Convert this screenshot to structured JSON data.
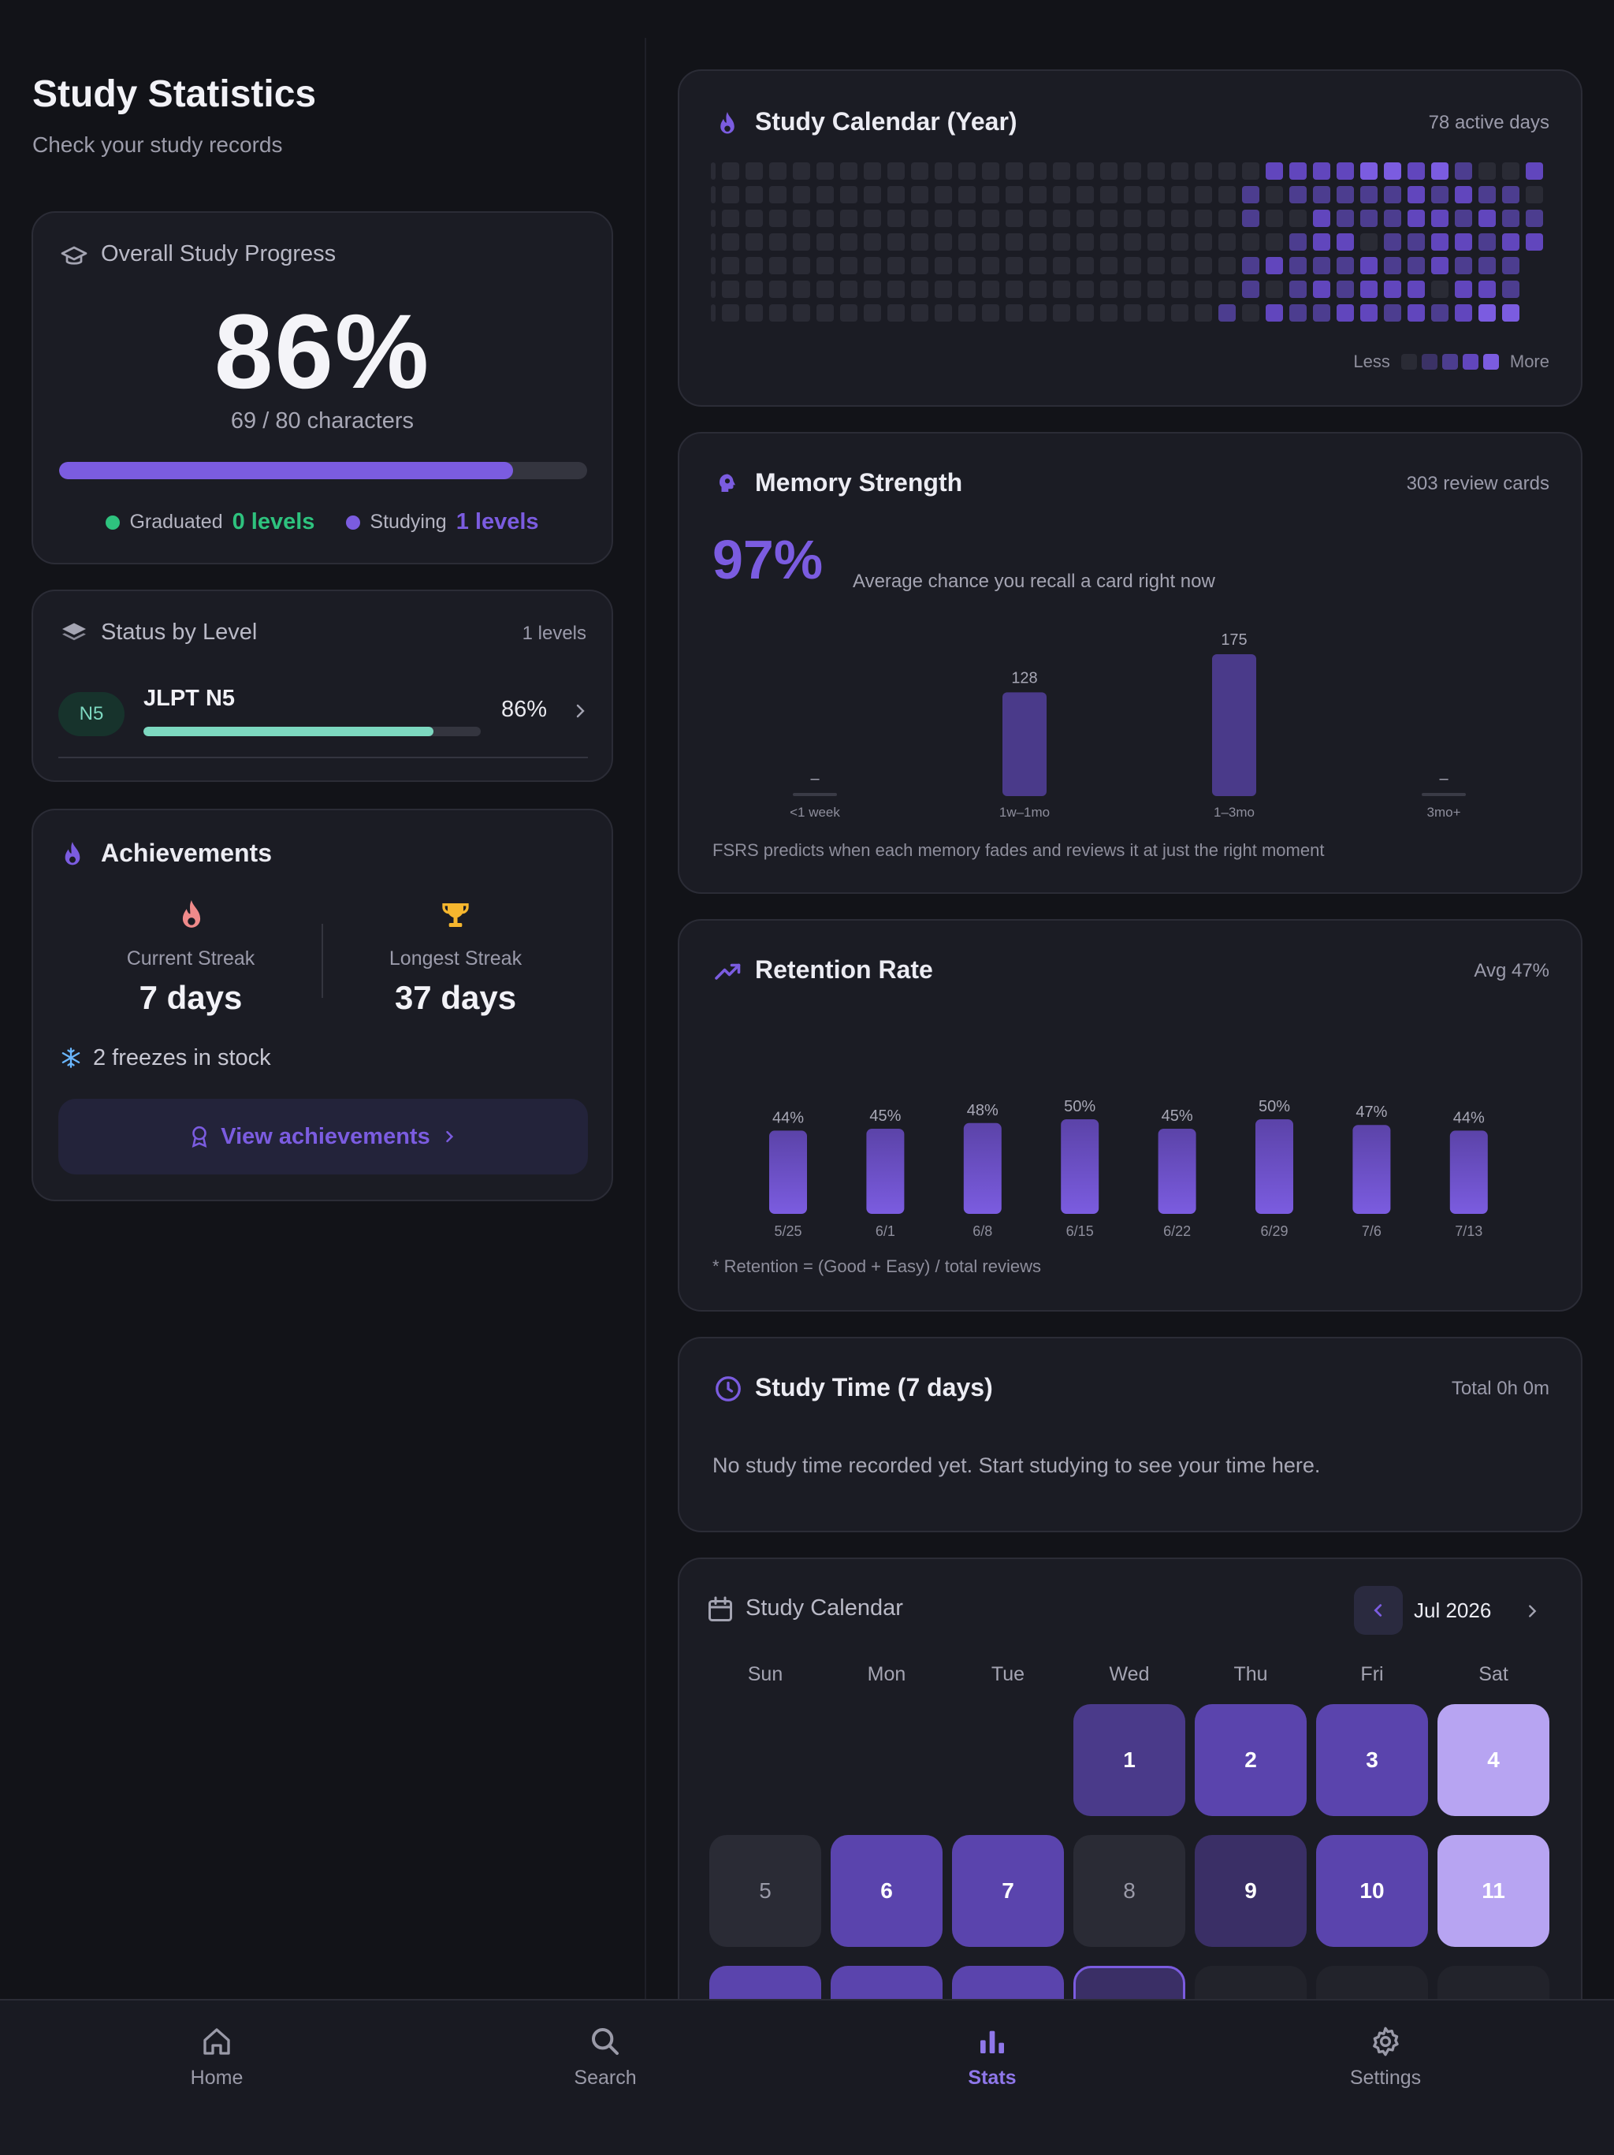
{
  "page": {
    "title": "Study Statistics",
    "subtitle": "Check your study records"
  },
  "overall": {
    "title": "Overall Study Progress",
    "percent": "86%",
    "count": "69 / 80 characters",
    "progress": 0.86,
    "graduated_label": "Graduated",
    "graduated_value": "0 levels",
    "studying_label": "Studying",
    "studying_value": "1 levels"
  },
  "levels": {
    "title": "Status by Level",
    "count": "1 levels",
    "items": [
      {
        "badge": "N5",
        "name": "JLPT N5",
        "percent": "86%",
        "progress": 0.86
      }
    ]
  },
  "achievements": {
    "title": "Achievements",
    "current_label": "Current Streak",
    "current_value": "7 days",
    "longest_label": "Longest Streak",
    "longest_value": "37 days",
    "freezes": "2 freezes in stock",
    "button": "View achievements"
  },
  "year_calendar": {
    "title": "Study Calendar (Year)",
    "active": "78 active days",
    "legend_less": "Less",
    "legend_more": "More"
  },
  "memory": {
    "title": "Memory Strength",
    "cards": "303 review cards",
    "percent": "97%",
    "caption": "Average chance you recall a card right now",
    "footnote": "FSRS predicts when each memory fades and reviews it at just the right moment",
    "chart_data": {
      "type": "bar",
      "categories": [
        "<1 week",
        "1w–1mo",
        "1–3mo",
        "3mo+"
      ],
      "values": [
        0,
        128,
        175,
        0
      ],
      "labels": [
        "–",
        "128",
        "175",
        "–"
      ],
      "ylim": [
        0,
        175
      ]
    }
  },
  "retention": {
    "title": "Retention Rate",
    "avg": "Avg 47%",
    "footnote": "* Retention = (Good + Easy) / total reviews",
    "chart_data": {
      "type": "bar",
      "categories": [
        "5/25",
        "6/1",
        "6/8",
        "6/15",
        "6/22",
        "6/29",
        "7/6",
        "7/13"
      ],
      "values": [
        44,
        45,
        48,
        50,
        45,
        50,
        47,
        44
      ],
      "labels": [
        "44%",
        "45%",
        "48%",
        "50%",
        "45%",
        "50%",
        "47%",
        "44%"
      ],
      "ylim": [
        0,
        50
      ]
    }
  },
  "study_time": {
    "title": "Study Time (7 days)",
    "total": "Total 0h 0m",
    "empty": "No study time recorded yet. Start studying to see your time here."
  },
  "month_calendar": {
    "title": "Study Calendar",
    "month": "Jul 2026",
    "weekdays": [
      "Sun",
      "Mon",
      "Tue",
      "Wed",
      "Thu",
      "Fri",
      "Sat"
    ],
    "days": [
      "1",
      "2",
      "3",
      "4",
      "5",
      "6",
      "7",
      "8",
      "9",
      "10",
      "11"
    ]
  },
  "nav": {
    "home": "Home",
    "search": "Search",
    "stats": "Stats",
    "settings": "Settings"
  },
  "colors": {
    "accent": "#7b5ce0",
    "green": "#2ec27e",
    "teal": "#7dd8c0",
    "bg": "#121318",
    "card": "#1b1c24"
  }
}
